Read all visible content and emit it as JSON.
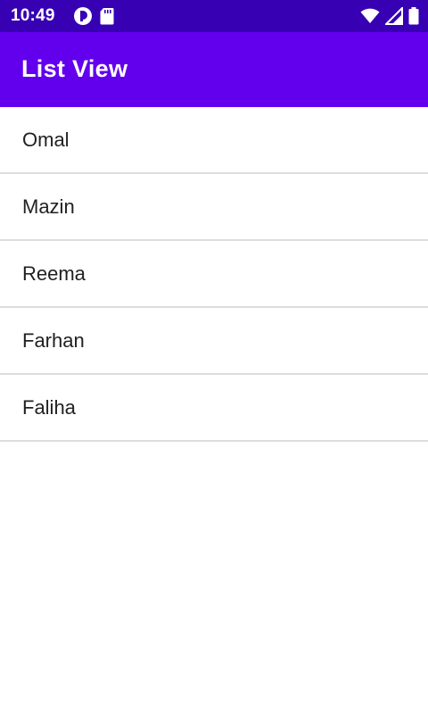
{
  "status_bar": {
    "time": "10:49",
    "left_icons": [
      "notification-circle-icon",
      "sd-card-icon"
    ],
    "right_icons": [
      "wifi-icon",
      "cell-signal-icon",
      "battery-icon"
    ]
  },
  "app_bar": {
    "title": "List View"
  },
  "list": {
    "items": [
      {
        "label": "Omal"
      },
      {
        "label": "Mazin"
      },
      {
        "label": "Reema"
      },
      {
        "label": "Farhan"
      },
      {
        "label": "Faliha"
      }
    ]
  },
  "colors": {
    "status_bar": "#3700b3",
    "app_bar": "#6200ee",
    "divider": "#dddddd",
    "text": "#212121"
  }
}
